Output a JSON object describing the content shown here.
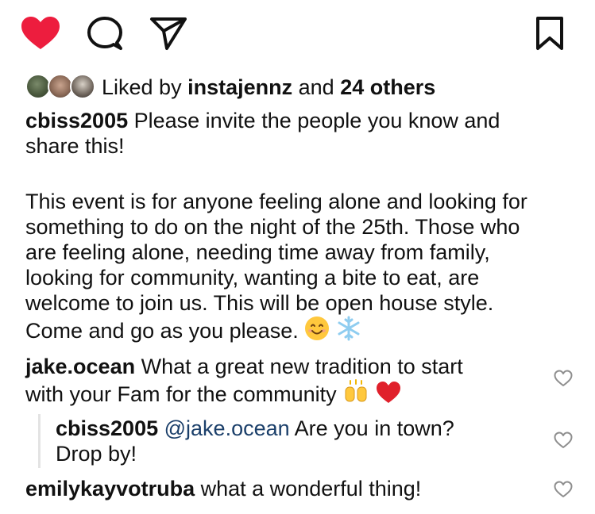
{
  "actions": {
    "like_icon": "heart-filled-icon",
    "comment_icon": "comment-icon",
    "share_icon": "send-icon",
    "save_icon": "bookmark-icon",
    "like_color": "#ED1D3E"
  },
  "likes": {
    "prefix": "Liked by",
    "user": "instajennz",
    "connector": "and",
    "others": "24 others"
  },
  "caption": {
    "username": "cbiss2005",
    "lines": [
      " Please invite the people you know and",
      "share this!",
      "This event is for anyone feeling alone and looking for",
      "something to do on the night of the 25th. Those who",
      "are feeling alone, needing time away from family,",
      "looking for community, wanting a bite to eat, are",
      "welcome to join us. This will be open house style.",
      "Come and go as you please."
    ],
    "emojis": [
      "smiling-face-emoji",
      "snowflake-emoji"
    ]
  },
  "comments": [
    {
      "username": "jake.ocean",
      "line1": " What a great new tradition to start",
      "line2": "with your Fam for the community",
      "emojis": [
        "raising-hands-emoji",
        "red-heart-emoji"
      ]
    },
    {
      "username": "cbiss2005",
      "mention": "@jake.ocean",
      "line1": " Are you in town?",
      "line2": "Drop by!"
    },
    {
      "username": "emilykayvotruba",
      "line1": " what a wonderful thing!"
    }
  ]
}
